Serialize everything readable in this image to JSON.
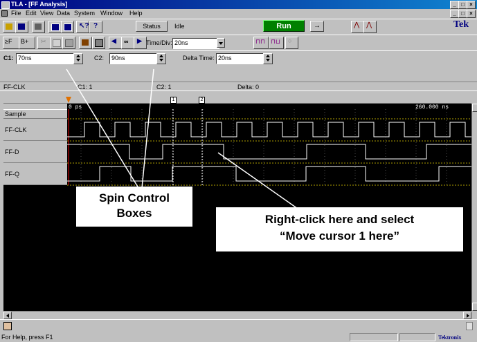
{
  "window": {
    "title": "TLA - [FF Analysis]"
  },
  "menu": [
    "File",
    "Edit",
    "View",
    "Data",
    "System",
    "Window",
    "Help"
  ],
  "toolbar1": {
    "status_label": "Status",
    "state_text": "Idle",
    "run_label": "Run",
    "brand": "Tek"
  },
  "toolbar2": {
    "timediv_label": "Time/Div:",
    "timediv_value": "20ns"
  },
  "cursors": {
    "c1_label": "C1:",
    "c1_value": "70ns",
    "c2_label": "C2:",
    "c2_value": "90ns",
    "delta_label": "Delta Time:",
    "delta_value": "20ns"
  },
  "readout": {
    "signal": "FF-CLK",
    "c1": "C1: 1",
    "c2": "C2: 1",
    "delta": "Delta: 0"
  },
  "waveform": {
    "header_label": "Sample",
    "time_start": "0 ps",
    "time_end": "260.000 ns",
    "signals": [
      "FF-CLK",
      "FF-D",
      "FF-Q"
    ]
  },
  "annotations": {
    "spin_line1": "Spin Control",
    "spin_line2": "Boxes",
    "right_line1": "Right-click here and select",
    "right_line2": "“Move cursor 1 here”"
  },
  "statusbar": {
    "help": "For Help, press F1",
    "brand": "Tektronix"
  }
}
